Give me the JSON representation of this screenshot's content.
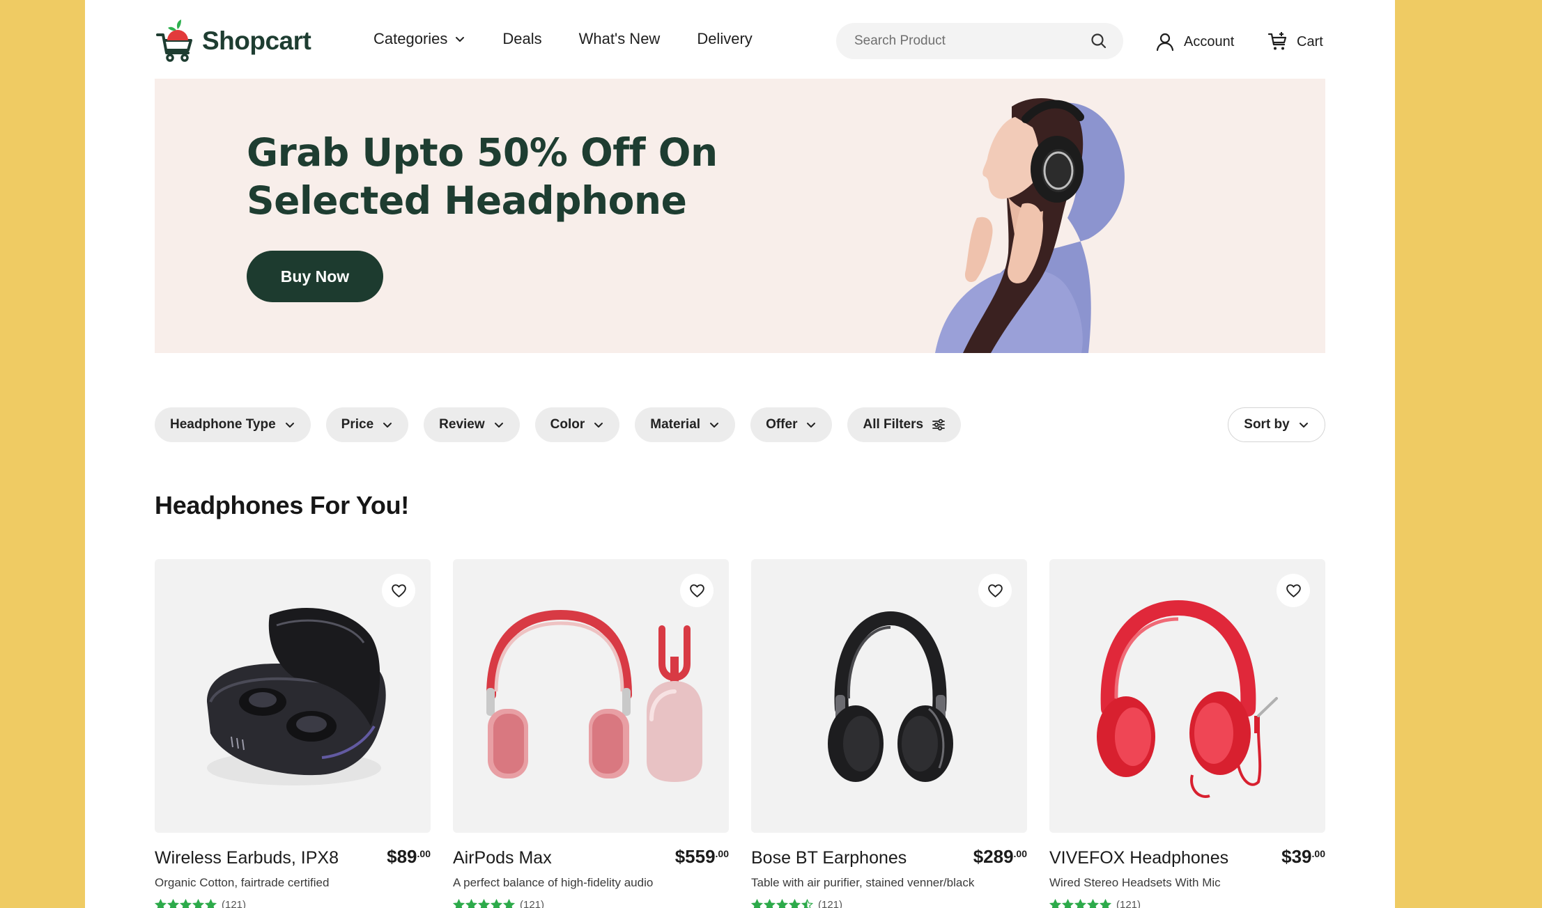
{
  "header": {
    "logo_text": "Shopcart",
    "nav": [
      {
        "label": "Categories",
        "has_dropdown": true
      },
      {
        "label": "Deals",
        "has_dropdown": false
      },
      {
        "label": "What's New",
        "has_dropdown": false
      },
      {
        "label": "Delivery",
        "has_dropdown": false
      }
    ],
    "search_placeholder": "Search Product",
    "account_label": "Account",
    "cart_label": "Cart"
  },
  "hero": {
    "title": "Grab Upto 50% Off On\nSelected Headphone",
    "button_label": "Buy Now"
  },
  "filters": [
    {
      "label": "Headphone Type",
      "icon": "chevron-down-icon"
    },
    {
      "label": "Price",
      "icon": "chevron-down-icon"
    },
    {
      "label": "Review",
      "icon": "chevron-down-icon"
    },
    {
      "label": "Color",
      "icon": "chevron-down-icon"
    },
    {
      "label": "Material",
      "icon": "chevron-down-icon"
    },
    {
      "label": "Offer",
      "icon": "chevron-down-icon"
    },
    {
      "label": "All Filters",
      "icon": "sliders-icon"
    }
  ],
  "sort_label": "Sort by",
  "section_title": "Headphones For You!",
  "products": [
    {
      "name": "Wireless Earbuds, IPX8",
      "price_main": "$89",
      "price_cents": ".00",
      "description": "Organic Cotton, fairtrade certified",
      "rating_count": "(121)",
      "stars": 5
    },
    {
      "name": "AirPods Max",
      "price_main": "$559",
      "price_cents": ".00",
      "description": "A perfect balance of high-fidelity audio",
      "rating_count": "(121)",
      "stars": 5
    },
    {
      "name": "Bose BT Earphones",
      "price_main": "$289",
      "price_cents": ".00",
      "description": "Table with air purifier, stained venner/black",
      "rating_count": "(121)",
      "stars": 4.5
    },
    {
      "name": "VIVEFOX Headphones",
      "price_main": "$39",
      "price_cents": ".00",
      "description": "Wired Stereo Headsets With Mic",
      "rating_count": "(121)",
      "stars": 5
    }
  ],
  "colors": {
    "page_background": "#EFCB63",
    "brand_green": "#1E3D31",
    "hero_background": "#F8EEEA",
    "star_green": "#2DAA4A"
  }
}
